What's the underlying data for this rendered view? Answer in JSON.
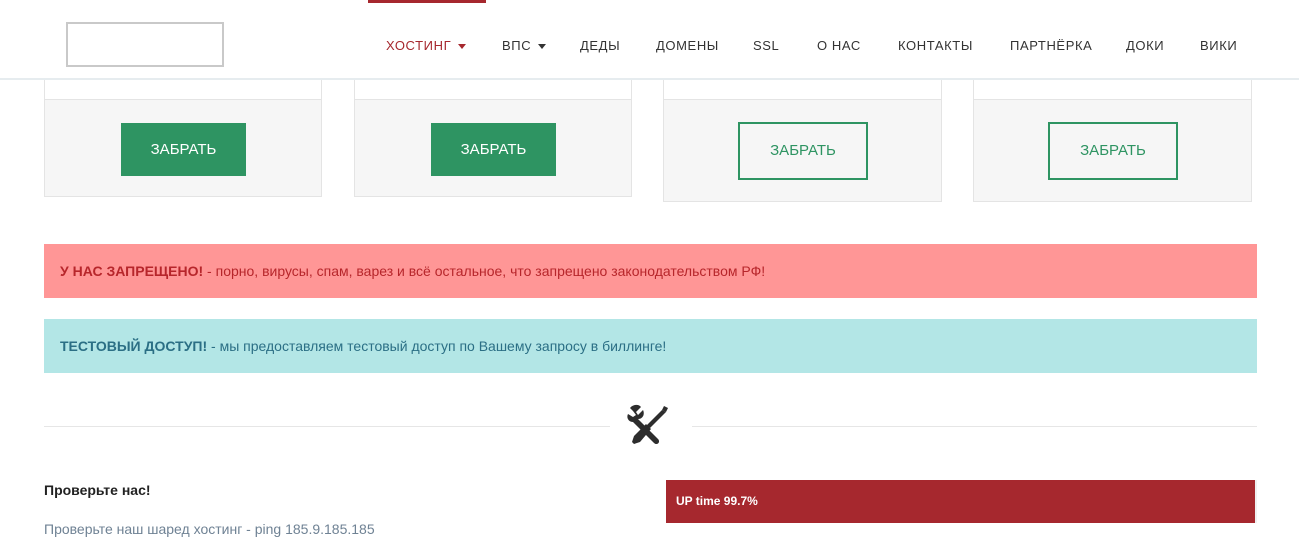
{
  "nav": {
    "items": [
      {
        "label": "ХОСТИНГ",
        "active": true,
        "dropdown": true
      },
      {
        "label": "ВПС",
        "active": false,
        "dropdown": true
      },
      {
        "label": "ДЕДЫ",
        "active": false,
        "dropdown": false
      },
      {
        "label": "ДОМЕНЫ",
        "active": false,
        "dropdown": false
      },
      {
        "label": "SSL",
        "active": false,
        "dropdown": false
      },
      {
        "label": "О НАС",
        "active": false,
        "dropdown": false
      },
      {
        "label": "КОНТАКТЫ",
        "active": false,
        "dropdown": false
      },
      {
        "label": "ПАРТНЁРКА",
        "active": false,
        "dropdown": false
      },
      {
        "label": "ДОКИ",
        "active": false,
        "dropdown": false
      },
      {
        "label": "ВИКИ",
        "active": false,
        "dropdown": false
      }
    ]
  },
  "plans": [
    {
      "button_label": "ЗАБРАТЬ",
      "style": "solid"
    },
    {
      "button_label": "ЗАБРАТЬ",
      "style": "solid"
    },
    {
      "button_label": "ЗАБРАТЬ",
      "style": "outline"
    },
    {
      "button_label": "ЗАБРАТЬ",
      "style": "outline"
    }
  ],
  "alerts": {
    "forbidden": {
      "strong": "У НАС ЗАПРЕЩЕНО!",
      "text": " - порно, вирусы, спам, варез и всё остальное, что запрещено законодательством РФ!"
    },
    "trial": {
      "strong": "ТЕСТОВЫЙ ДОСТУП!",
      "text": " - мы предоставляем тестовый доступ по Вашему запросу в биллинге!"
    }
  },
  "divider": {
    "icon": "tools-icon"
  },
  "check": {
    "title": "Проверьте нас!",
    "text": "Проверьте наш шаред хостинг - ping 185.9.185.185"
  },
  "uptime": {
    "label": "UP time 99.7%",
    "percent": 99.7
  },
  "colors": {
    "brand_red": "#a6282e",
    "green": "#2e9462",
    "danger_bg": "#ff9696",
    "info_bg": "#b3e6e6"
  }
}
